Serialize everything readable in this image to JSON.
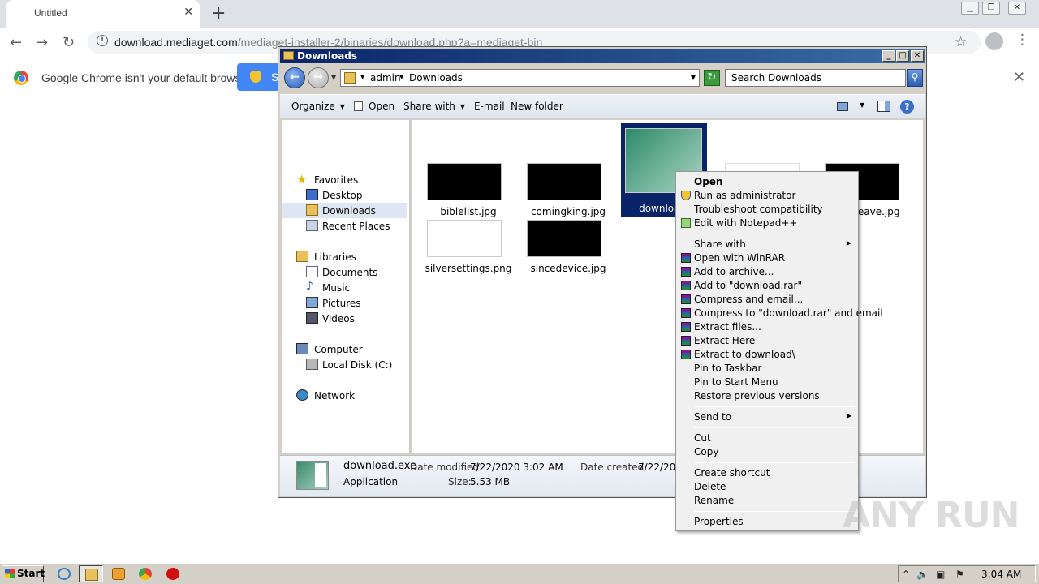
{
  "chrome": {
    "tab_title": "Untitled",
    "tab_close": "✕",
    "new_tab": "+",
    "url_host": "download.mediaget.com",
    "url_path": "/mediaget-installer-2/binaries/download.php?a=mediaget-bin",
    "infobar_message": "Google Chrome isn't your default browser",
    "infobar_button_partial": "S",
    "infobar_close": "✕"
  },
  "explorer": {
    "title": "Downloads",
    "breadcrumb": [
      "admin",
      "Downloads"
    ],
    "search_placeholder": "Search Downloads",
    "commands": {
      "organize": "Organize",
      "open": "Open",
      "share_with": "Share with",
      "email": "E-mail",
      "new_folder": "New folder"
    },
    "nav": {
      "favorites": "Favorites",
      "desktop": "Desktop",
      "downloads": "Downloads",
      "recent_places": "Recent Places",
      "libraries": "Libraries",
      "documents": "Documents",
      "music": "Music",
      "pictures": "Pictures",
      "videos": "Videos",
      "computer": "Computer",
      "local_disk": "Local Disk (C:)",
      "network": "Network"
    },
    "files": {
      "biblelist": "biblelist.jpg",
      "comingking": "comingking.jpg",
      "download_partial": "download.",
      "leave_partial": "leave.jpg",
      "silversettings": "silversettings.png",
      "sincedevice": "sincedevice.jpg"
    },
    "details": {
      "name": "download.exe",
      "type": "Application",
      "date_modified_label": "Date modified:",
      "date_modified": "7/22/2020 3:02 AM",
      "size_label": "Size:",
      "size": "5.53 MB",
      "date_created_label": "Date created:",
      "date_created_partial": "7/22/2020"
    }
  },
  "context_menu": {
    "open": "Open",
    "run_as_admin": "Run as administrator",
    "troubleshoot": "Troubleshoot compatibility",
    "edit_notepad": "Edit with Notepad++",
    "share_with": "Share with",
    "open_winrar": "Open with WinRAR",
    "add_archive": "Add to archive...",
    "add_download_rar": "Add to \"download.rar\"",
    "compress_email": "Compress and email...",
    "compress_download_email": "Compress to \"download.rar\" and email",
    "extract_files": "Extract files...",
    "extract_here": "Extract Here",
    "extract_to": "Extract to download\\",
    "pin_taskbar": "Pin to Taskbar",
    "pin_start": "Pin to Start Menu",
    "restore_versions": "Restore previous versions",
    "send_to": "Send to",
    "cut": "Cut",
    "copy": "Copy",
    "create_shortcut": "Create shortcut",
    "delete": "Delete",
    "rename": "Rename",
    "properties": "Properties"
  },
  "taskbar": {
    "start": "Start",
    "clock": "3:04 AM"
  },
  "watermark": "ANY RUN",
  "icons": {
    "back": "←",
    "forward": "→",
    "reload": "↻",
    "star": "☆",
    "menu": "⋮",
    "submenu_arrow": "▶",
    "dropdown": "▼",
    "help": "?"
  }
}
